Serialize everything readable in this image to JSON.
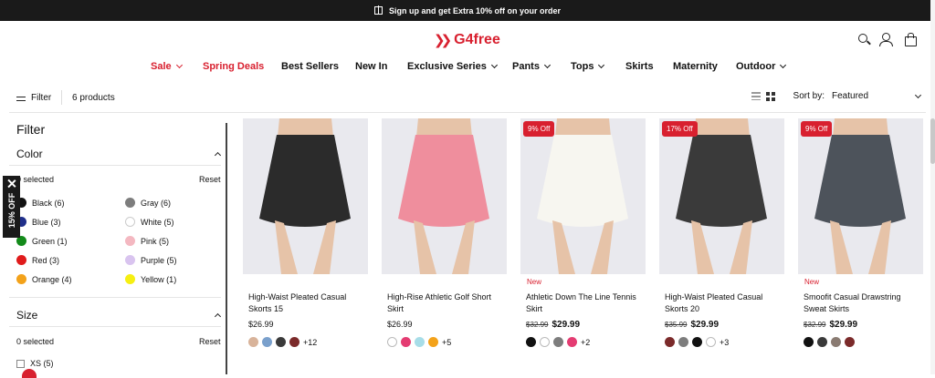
{
  "announcement": "Sign up and get Extra 10% off on your order",
  "brand": "G4free",
  "nav": [
    {
      "label": "Sale",
      "dropdown": true,
      "red": true
    },
    {
      "label": "Spring Deals",
      "dropdown": false,
      "red": true
    },
    {
      "label": "Best Sellers",
      "dropdown": false,
      "red": false
    },
    {
      "label": "New In",
      "dropdown": false,
      "red": false
    },
    {
      "label": "Exclusive Series",
      "dropdown": true,
      "red": false
    },
    {
      "label": "Pants",
      "dropdown": true,
      "red": false
    },
    {
      "label": "Tops",
      "dropdown": true,
      "red": false
    },
    {
      "label": "Skirts",
      "dropdown": false,
      "red": false
    },
    {
      "label": "Maternity",
      "dropdown": false,
      "red": false
    },
    {
      "label": "Outdoor",
      "dropdown": true,
      "red": false
    }
  ],
  "toolbar": {
    "filter_label": "Filter",
    "count": "6 products",
    "sort_label": "Sort by:",
    "sort_value": "Featured"
  },
  "sidebar": {
    "title": "Filter",
    "color": {
      "title": "Color",
      "selected": "0 selected",
      "reset": "Reset",
      "options": [
        {
          "label": "Black (6)",
          "color": "#111111"
        },
        {
          "label": "Gray (6)",
          "color": "#7d7d7d"
        },
        {
          "label": "Blue (3)",
          "color": "#1f2f8a"
        },
        {
          "label": "White (5)",
          "color": "#ffffff"
        },
        {
          "label": "Green (1)",
          "color": "#138a1a"
        },
        {
          "label": "Pink (5)",
          "color": "#f4b8c1"
        },
        {
          "label": "Red (3)",
          "color": "#e01b1b"
        },
        {
          "label": "Purple (5)",
          "color": "#d9c4ef"
        },
        {
          "label": "Orange (4)",
          "color": "#f3a21a"
        },
        {
          "label": "Yellow (1)",
          "color": "#f6ef12"
        }
      ]
    },
    "size": {
      "title": "Size",
      "selected": "0 selected",
      "reset": "Reset",
      "options": [
        "XS (5)"
      ]
    }
  },
  "promo_tab": "15% OFF",
  "products": [
    {
      "name": "High-Waist Pleated Casual Skorts 15",
      "badge": "",
      "new": "",
      "old_price": "",
      "price": "$26.99",
      "garment": "#2b2b2b",
      "swatches": [
        "#d8b39a",
        "#7aa0cc",
        "#3a3a3a",
        "#7b2a2a"
      ],
      "more": "+12"
    },
    {
      "name": "High-Rise Athletic Golf Short Skirt",
      "badge": "",
      "new": "",
      "old_price": "",
      "price": "$26.99",
      "garment": "#ef8e9d",
      "swatches": [
        "#ffffff",
        "#e43c72",
        "#a7dde8",
        "#f3a21a"
      ],
      "more": "+5"
    },
    {
      "name": "Athletic Down The Line Tennis Skirt",
      "badge": "9% Off",
      "new": "New",
      "old_price": "$32.99",
      "price": "$29.99",
      "garment": "#f7f6f0",
      "swatches": [
        "#111111",
        "#ffffff",
        "#7d7d7d",
        "#e43c72"
      ],
      "more": "+2"
    },
    {
      "name": "High-Waist Pleated Casual Skorts 20",
      "badge": "17% Off",
      "new": "",
      "old_price": "$35.99",
      "price": "$29.99",
      "garment": "#3a3a3a",
      "swatches": [
        "#7b2a2a",
        "#7d7d7d",
        "#111111",
        "#ffffff"
      ],
      "more": "+3"
    },
    {
      "name": "Smoofit Casual Drawstring Sweat Skirts",
      "badge": "9% Off",
      "new": "New",
      "old_price": "$32.99",
      "price": "$29.99",
      "garment": "#4d535b",
      "swatches": [
        "#111111",
        "#3a3a3a",
        "#8a7b72",
        "#7b2a2a"
      ],
      "more": ""
    }
  ]
}
